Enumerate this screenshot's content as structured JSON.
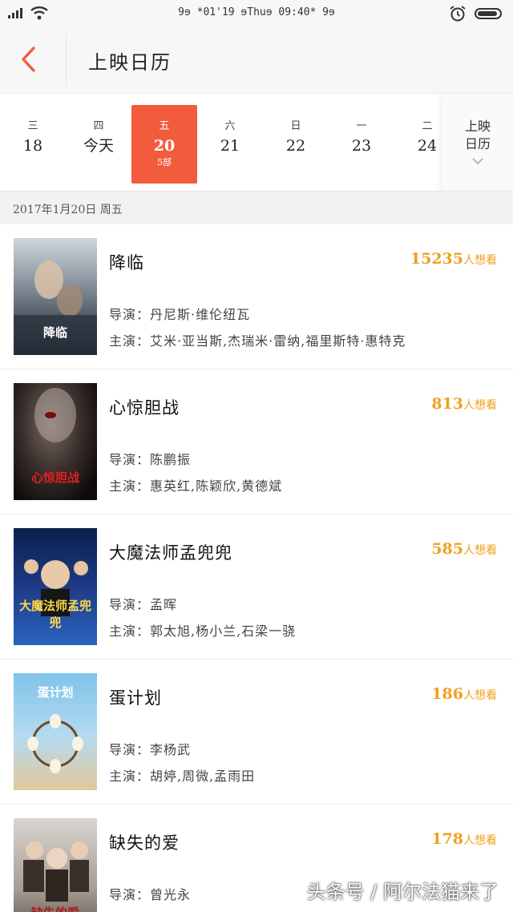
{
  "status_bar": {
    "center_text": "9ɘ *01'19 ɘThuɘ 09:40* 9ɘ"
  },
  "header": {
    "title": "上映日历"
  },
  "dates": [
    {
      "weekday": "三",
      "day": "18",
      "active": false
    },
    {
      "weekday": "四",
      "day": "今天",
      "active": false
    },
    {
      "weekday": "五",
      "day": "20",
      "count": "5部",
      "active": true
    },
    {
      "weekday": "六",
      "day": "21",
      "active": false
    },
    {
      "weekday": "日",
      "day": "22",
      "active": false
    },
    {
      "weekday": "一",
      "day": "23",
      "active": false
    },
    {
      "weekday": "二",
      "day": "24",
      "active": false
    }
  ],
  "calendar_button": {
    "line1": "上映",
    "line2": "日历"
  },
  "date_header": "2017年1月20日 周五",
  "want_suffix": "人想看",
  "movies": [
    {
      "title": "降临",
      "want": "15235",
      "director": "导演：丹尼斯·维伦纽瓦",
      "cast": "主演：艾米·亚当斯,杰瑞米·雷纳,福里斯特·惠特克",
      "poster_text": "降临"
    },
    {
      "title": "心惊胆战",
      "want": "813",
      "director": "导演：陈鹏振",
      "cast": "主演：惠英红,陈颖欣,黄德斌",
      "poster_text": "心惊胆战"
    },
    {
      "title": "大魔法师孟兜兜",
      "want": "585",
      "director": "导演：孟晖",
      "cast": "主演：郭太旭,杨小兰,石梁一骁",
      "poster_text": "大魔法师孟兜兜"
    },
    {
      "title": "蛋计划",
      "want": "186",
      "director": "导演：李杨武",
      "cast": "主演：胡婷,周微,孟雨田",
      "poster_text": "蛋计划"
    },
    {
      "title": "缺失的爱",
      "want": "178",
      "director": "导演：曾光永",
      "cast": "",
      "poster_text": "缺失的爱"
    }
  ],
  "watermark": "头条号 / 阿尔法猫来了",
  "colors": {
    "accent": "#f35b3d",
    "want": "#f0a01e"
  }
}
